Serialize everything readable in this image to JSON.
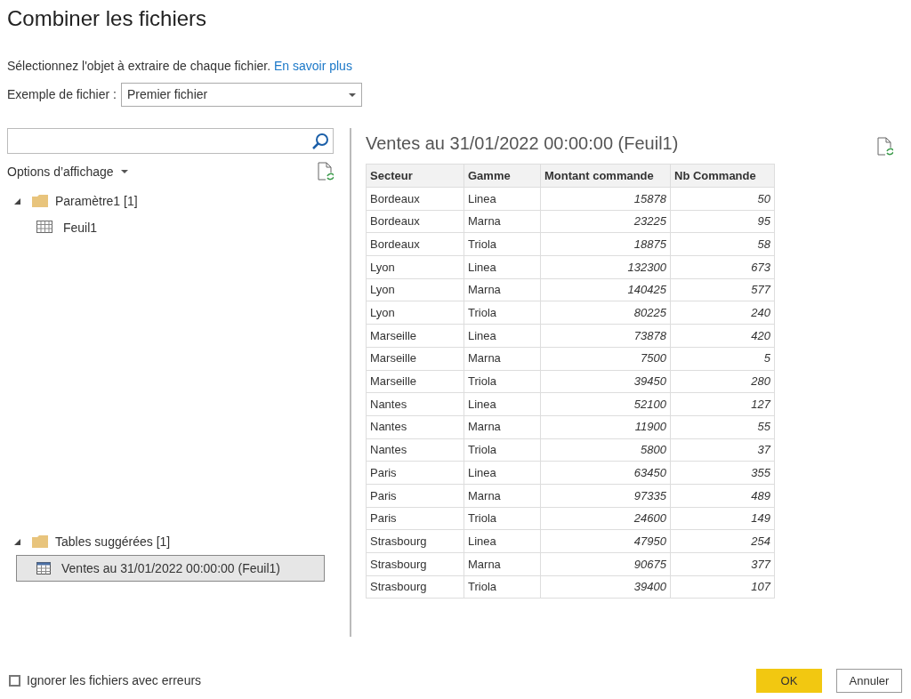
{
  "dialog": {
    "title": "Combiner les fichiers"
  },
  "instruction": {
    "text": "Sélectionnez l'objet à extraire de chaque fichier.",
    "link": "En savoir plus"
  },
  "sample_file": {
    "label": "Exemple de fichier :",
    "value": "Premier fichier"
  },
  "navigator": {
    "display_options": "Options d’affichage",
    "tree": [
      {
        "label": "Paramètre1 [1]",
        "kind": "folder",
        "expanded": true,
        "children": [
          {
            "label": "Feuil1",
            "kind": "sheet",
            "selected": false
          }
        ]
      }
    ],
    "suggested": [
      {
        "label": "Tables suggérées [1]",
        "kind": "folder",
        "expanded": true,
        "children": [
          {
            "label": "Ventes au 31/01/2022 00:00:00 (Feuil1)",
            "kind": "table",
            "selected": true
          }
        ]
      }
    ]
  },
  "preview": {
    "title": "Ventes au 31/01/2022 00:00:00 (Feuil1)",
    "columns": [
      "Secteur",
      "Gamme",
      "Montant commande",
      "Nb Commande"
    ],
    "rows": [
      [
        "Bordeaux",
        "Linea",
        "15878",
        "50"
      ],
      [
        "Bordeaux",
        "Marna",
        "23225",
        "95"
      ],
      [
        "Bordeaux",
        "Triola",
        "18875",
        "58"
      ],
      [
        "Lyon",
        "Linea",
        "132300",
        "673"
      ],
      [
        "Lyon",
        "Marna",
        "140425",
        "577"
      ],
      [
        "Lyon",
        "Triola",
        "80225",
        "240"
      ],
      [
        "Marseille",
        "Linea",
        "73878",
        "420"
      ],
      [
        "Marseille",
        "Marna",
        "7500",
        "5"
      ],
      [
        "Marseille",
        "Triola",
        "39450",
        "280"
      ],
      [
        "Nantes",
        "Linea",
        "52100",
        "127"
      ],
      [
        "Nantes",
        "Marna",
        "11900",
        "55"
      ],
      [
        "Nantes",
        "Triola",
        "5800",
        "37"
      ],
      [
        "Paris",
        "Linea",
        "63450",
        "355"
      ],
      [
        "Paris",
        "Marna",
        "97335",
        "489"
      ],
      [
        "Paris",
        "Triola",
        "24600",
        "149"
      ],
      [
        "Strasbourg",
        "Linea",
        "47950",
        "254"
      ],
      [
        "Strasbourg",
        "Marna",
        "90675",
        "377"
      ],
      [
        "Strasbourg",
        "Triola",
        "39400",
        "107"
      ]
    ]
  },
  "footer": {
    "skip_errors": {
      "label": "Ignorer les fichiers avec erreurs",
      "checked": false
    },
    "buttons": [
      {
        "label": "OK",
        "kind": "primary"
      },
      {
        "label": "Annuler",
        "kind": "secondary"
      }
    ]
  }
}
